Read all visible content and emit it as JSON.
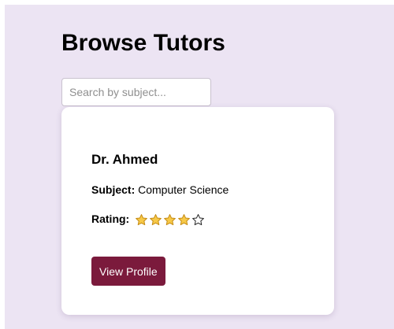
{
  "header": {
    "title": "Browse Tutors"
  },
  "search": {
    "placeholder": "Search by subject...",
    "value": ""
  },
  "tutor": {
    "name": "Dr. Ahmed",
    "subject_label": "Subject:",
    "subject_value": "Computer Science",
    "rating_label": "Rating:",
    "rating": 4,
    "rating_max": 5,
    "button_label": "View Profile"
  },
  "colors": {
    "page_background": "#ece4f3",
    "button_background": "#7b1a3c",
    "star_fill": "#f7c948",
    "star_outline": "#222222"
  },
  "icons": {
    "filled_star": "star-filled-icon",
    "empty_star": "star-empty-icon"
  }
}
